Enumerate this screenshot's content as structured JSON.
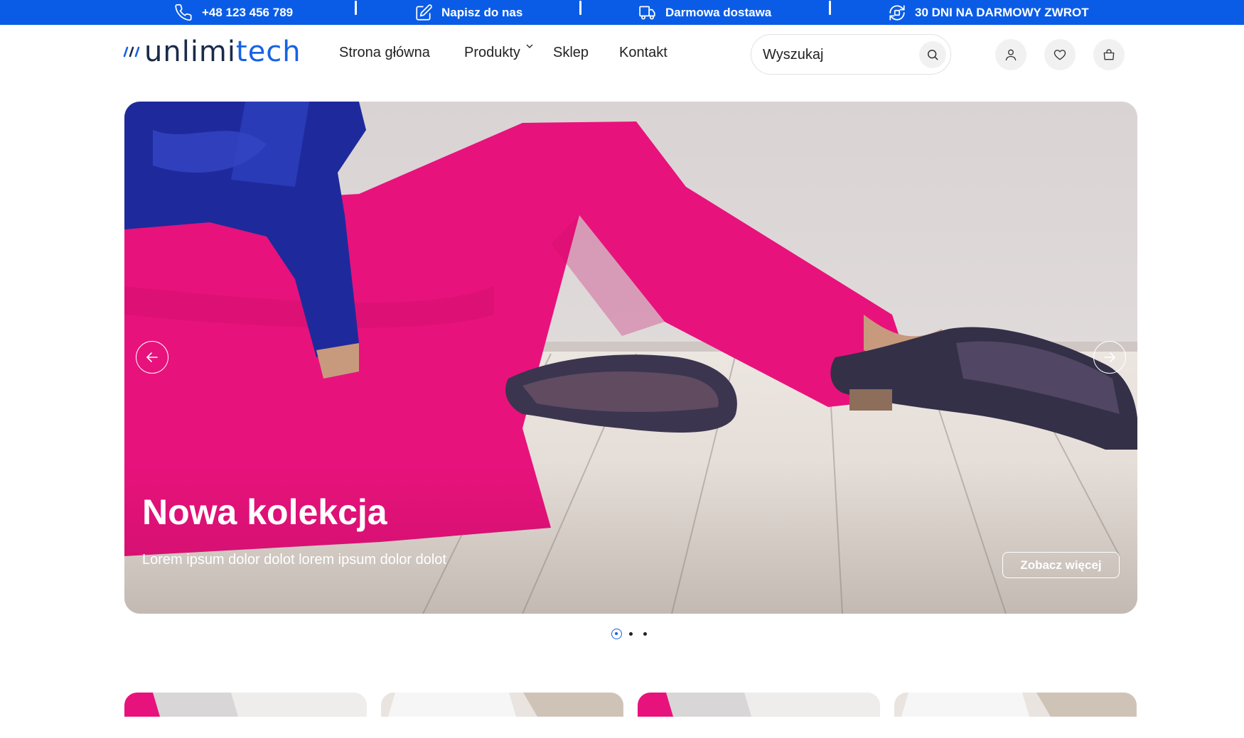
{
  "topbar": {
    "items": [
      {
        "label": "+48 123 456 789",
        "icon": "phone-icon"
      },
      {
        "label": "Napisz do nas",
        "icon": "edit-icon"
      },
      {
        "label": "Darmowa dostawa",
        "icon": "truck-icon"
      },
      {
        "label": "30 DNI NA DARMOWY ZWROT",
        "icon": "return-icon"
      }
    ],
    "background": "#0a5ce6"
  },
  "header": {
    "logo": {
      "part_a": "unlimi",
      "part_b": "tech"
    },
    "nav": [
      {
        "label": "Strona główna"
      },
      {
        "label": "Produkty",
        "has_dropdown": true
      },
      {
        "label": "Sklep"
      },
      {
        "label": "Kontakt"
      }
    ],
    "search": {
      "placeholder": "Wyszukaj"
    },
    "icons": [
      "user-icon",
      "heart-icon",
      "bag-icon"
    ]
  },
  "hero": {
    "title": "Nowa kolekcja",
    "subtitle": "Lorem ipsum dolor dolot lorem ipsum dolor dolot",
    "button_label": "Zobacz więcej",
    "slides_count": 3,
    "active_slide": 1
  },
  "colors": {
    "accent": "#1662e5",
    "logo_dark": "#1b2a4a",
    "hero_pink": "#e8127c",
    "hero_blue": "#1e2a9c"
  }
}
